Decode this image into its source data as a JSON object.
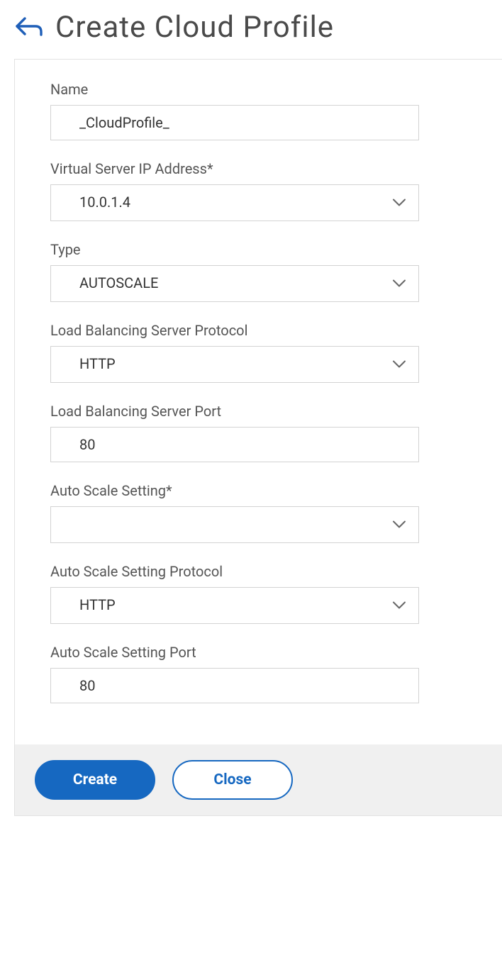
{
  "header": {
    "title": "Create Cloud Profile"
  },
  "form": {
    "name": {
      "label": "Name",
      "value": "_CloudProfile_"
    },
    "vsip": {
      "label": "Virtual Server IP Address*",
      "value": "10.0.1.4"
    },
    "type": {
      "label": "Type",
      "value": "AUTOSCALE"
    },
    "lb_protocol": {
      "label": "Load Balancing Server Protocol",
      "value": "HTTP"
    },
    "lb_port": {
      "label": "Load Balancing Server Port",
      "value": "80"
    },
    "autoscale_setting": {
      "label": "Auto Scale Setting*",
      "value": ""
    },
    "autoscale_protocol": {
      "label": "Auto Scale Setting Protocol",
      "value": "HTTP"
    },
    "autoscale_port": {
      "label": "Auto Scale Setting Port",
      "value": "80"
    }
  },
  "footer": {
    "create": "Create",
    "close": "Close"
  }
}
